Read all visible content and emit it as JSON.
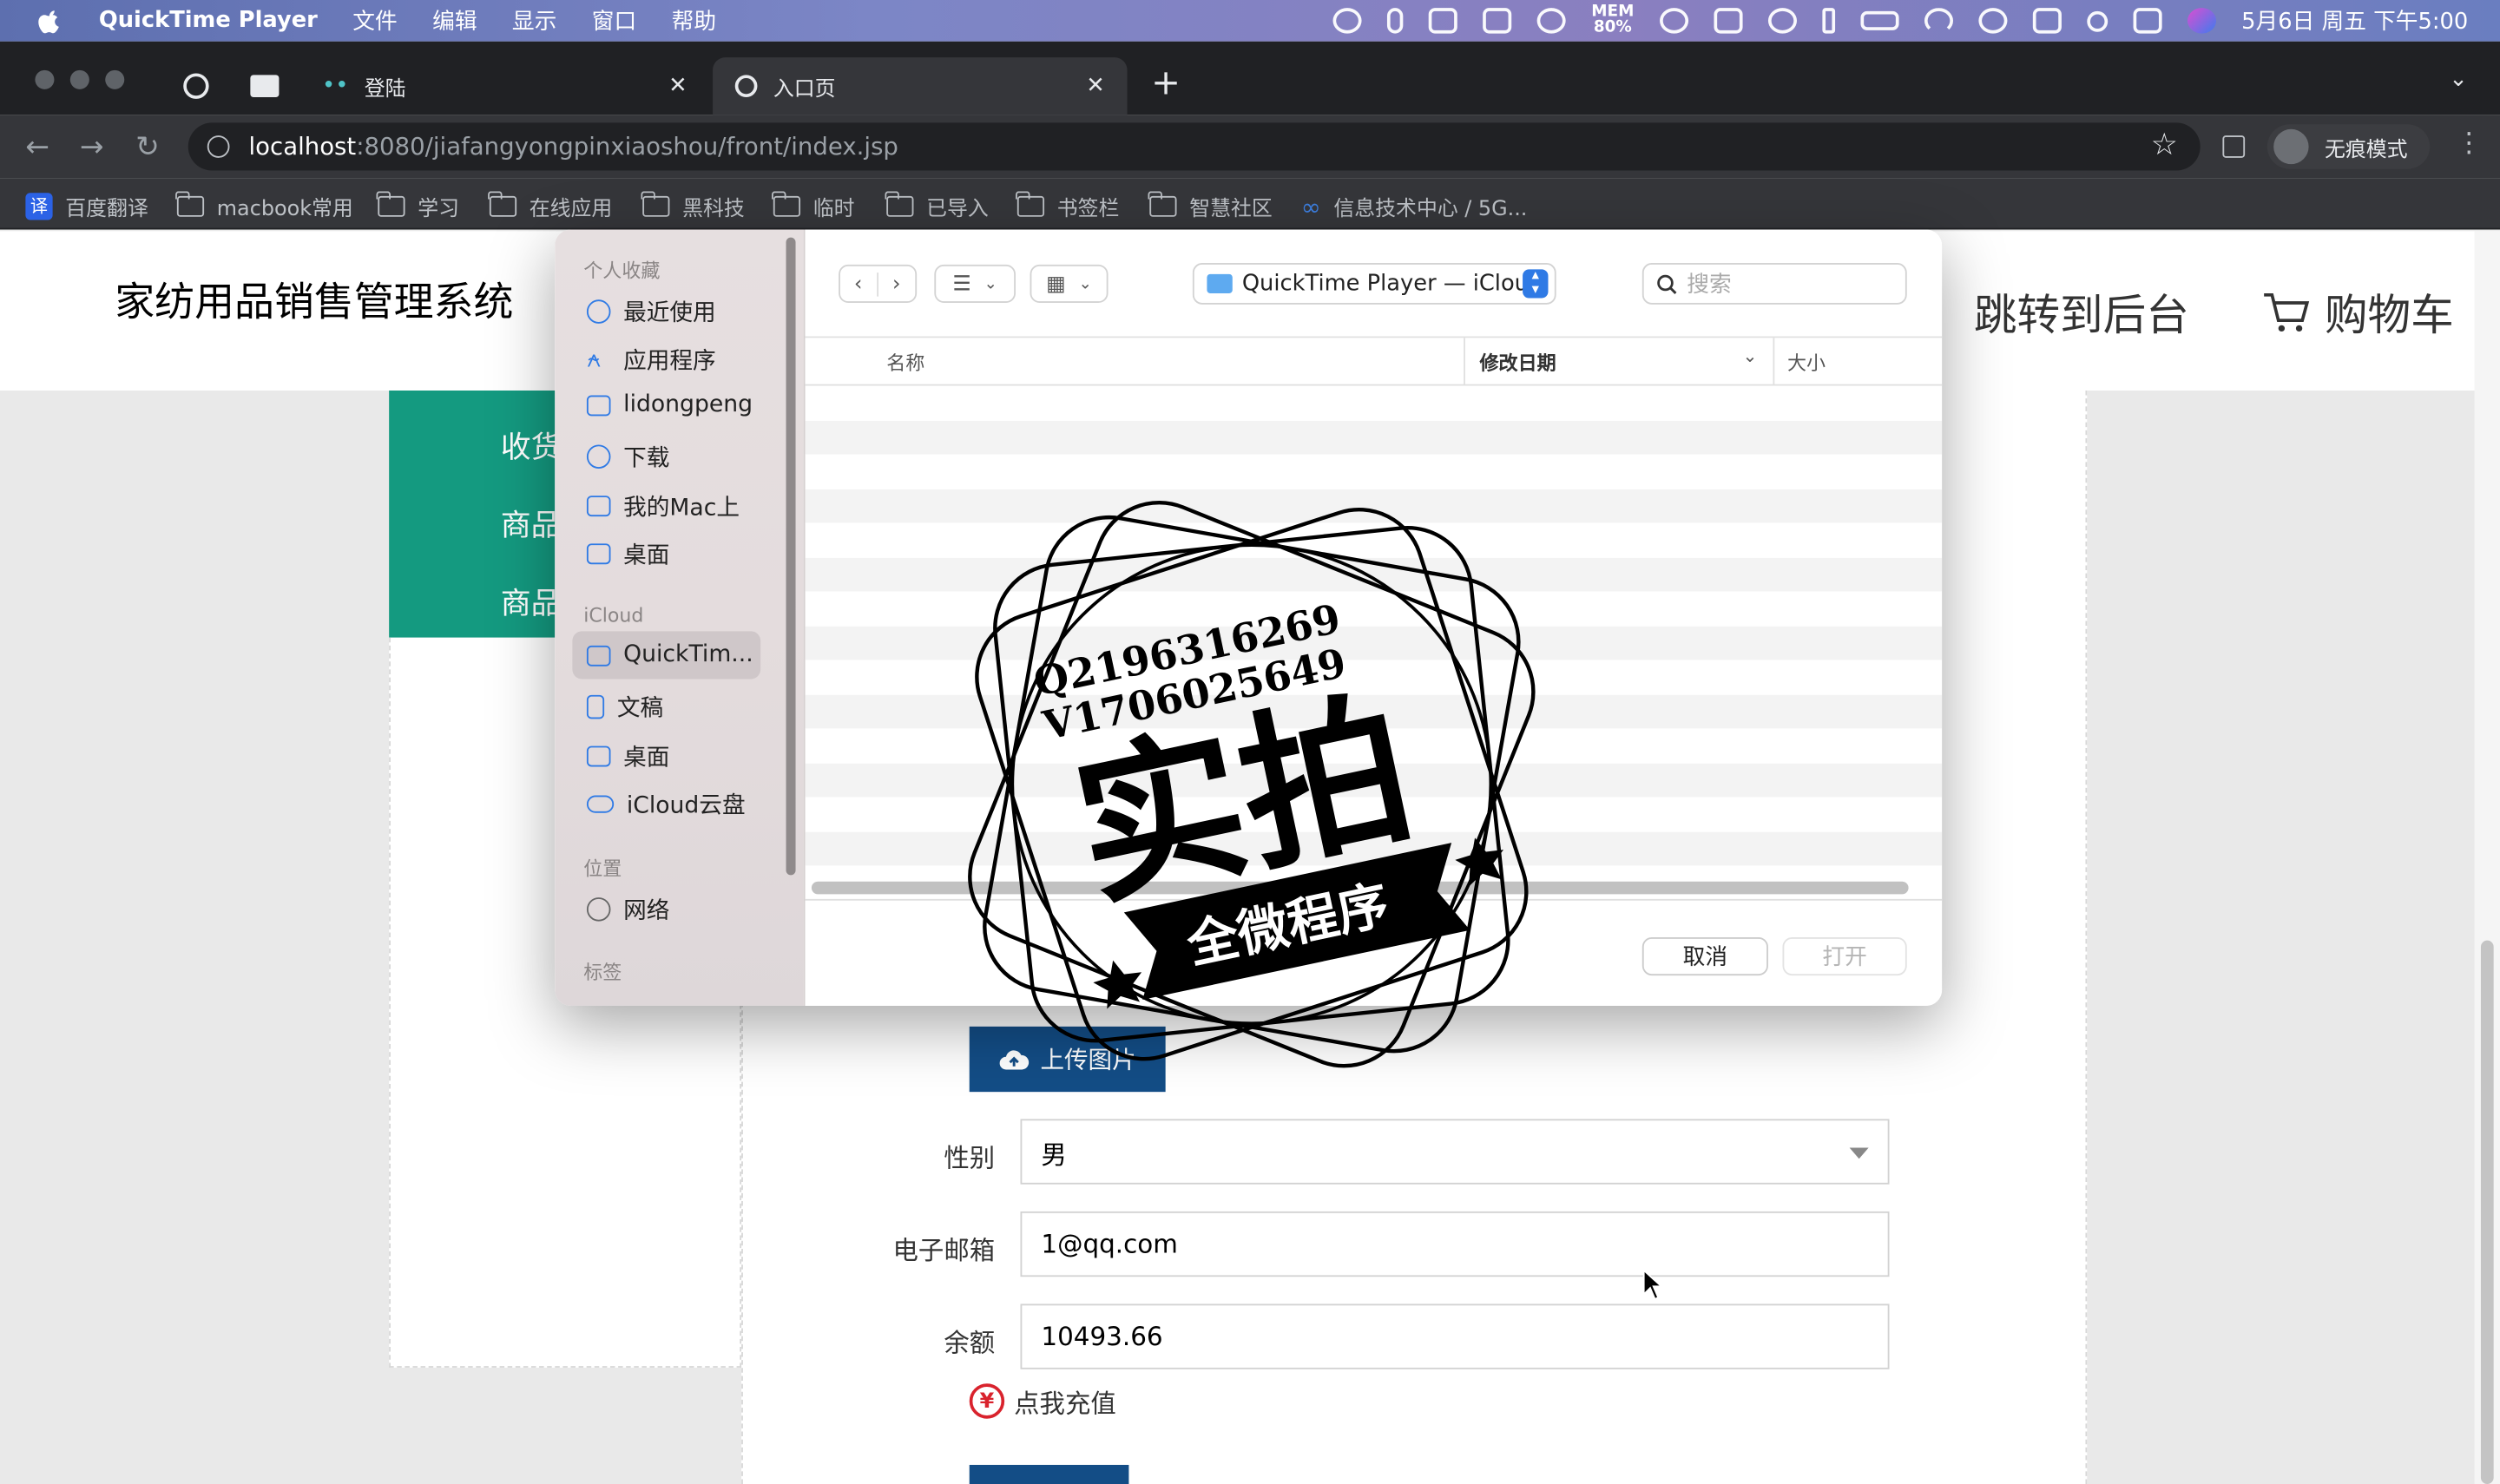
{
  "menubar": {
    "app": "QuickTime Player",
    "items": [
      "文件",
      "编辑",
      "显示",
      "窗口",
      "帮助"
    ],
    "mem": "MEM\n80%",
    "clock": "5月6日 周五 下午5:00"
  },
  "tabs": [
    {
      "label": "登陆"
    },
    {
      "label": "入口页"
    }
  ],
  "address": {
    "host": "localhost",
    "path": ":8080/jiafangyongpinxiaoshou/front/index.jsp"
  },
  "incognito": "无痕模式",
  "bookmarks": [
    "百度翻译",
    "macbook常用",
    "学习",
    "在线应用",
    "黑科技",
    "临时",
    "已导入",
    "书签栏",
    "智慧社区",
    "信息技术中心 / 5G..."
  ],
  "site": {
    "title": "家纺用品销售管理系统",
    "backstage": "跳转到后台",
    "cart": "购物车",
    "nav": [
      "收货",
      "商品",
      "商品"
    ]
  },
  "form": {
    "upload_label": "上传图片",
    "gender_label": "性别",
    "gender_value": "男",
    "email_label": "电子邮箱",
    "email_value": "1@qq.com",
    "balance_label": "余额",
    "balance_value": "10493.66",
    "recharge_label": "点我充值",
    "recharge_icon": "¥"
  },
  "dialog": {
    "sidebar": {
      "favorites_title": "个人收藏",
      "favorites": [
        "最近使用",
        "应用程序",
        "lidongpeng",
        "下载",
        "我的Mac上",
        "桌面"
      ],
      "icloud_title": "iCloud",
      "icloud": [
        "QuickTim...",
        "文稿",
        "桌面",
        "iCloud云盘"
      ],
      "locations_title": "位置",
      "locations": [
        "网络"
      ],
      "tags_title": "标签"
    },
    "location": "QuickTime Player — iCloud",
    "search_placeholder": "搜索",
    "columns": {
      "name": "名称",
      "modified": "修改日期",
      "size": "大小"
    },
    "cancel": "取消",
    "open": "打开"
  },
  "watermark": {
    "line1": "Q2196316269",
    "line2": "V1706025649",
    "main": "实拍",
    "banner": "全微程序"
  },
  "colors": {
    "teal": "#149a80",
    "navy": "#134d86",
    "accent": "#2f7ae5"
  }
}
